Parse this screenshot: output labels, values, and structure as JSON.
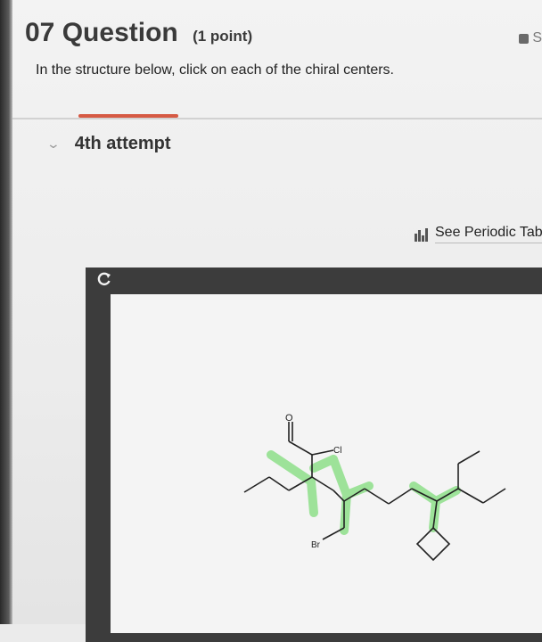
{
  "header": {
    "question_number": "07",
    "question_word": "Question",
    "points": "(1 point)",
    "top_right_letter": "S"
  },
  "prompt": "In the structure below, click on each of the chiral centers.",
  "attempt": {
    "label": "4th attempt"
  },
  "periodic_table": {
    "label": "See Periodic Table"
  },
  "molecule": {
    "atoms": {
      "oxygen": "O",
      "chlorine": "Cl",
      "bromine": "Br"
    },
    "highlight_color": "#8ee08a",
    "bond_color": "#222222"
  }
}
